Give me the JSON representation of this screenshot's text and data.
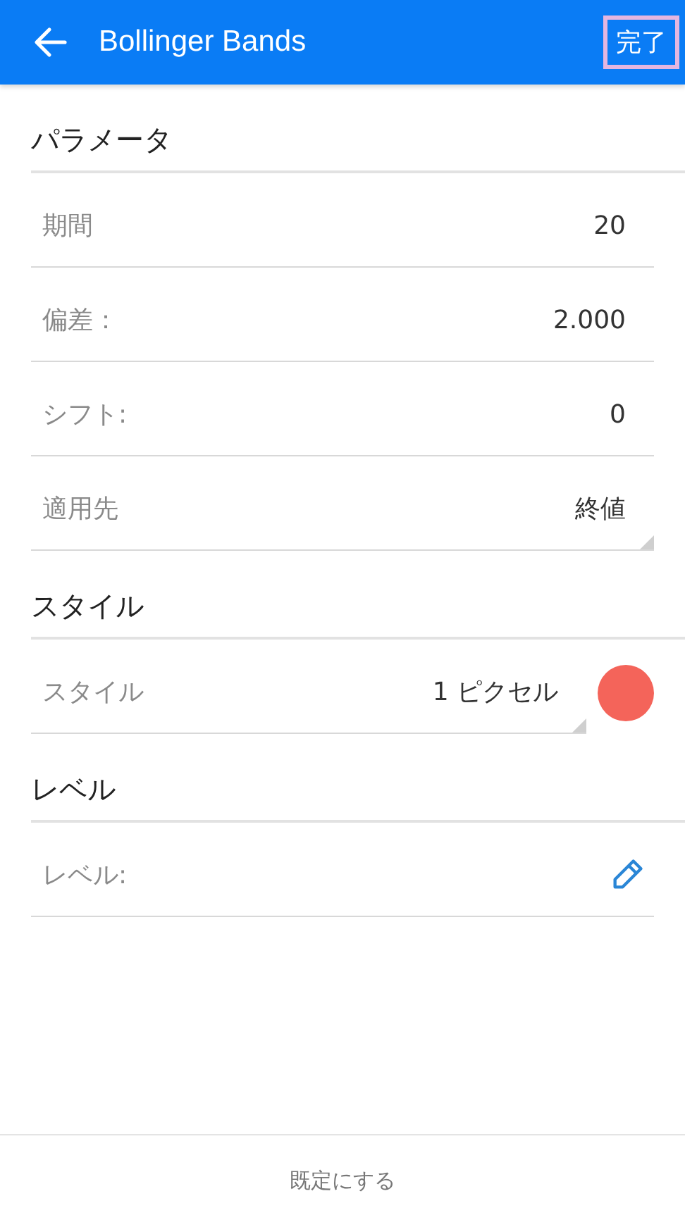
{
  "app_bar": {
    "title": "Bollinger Bands",
    "done_button": {
      "label": "完了",
      "outlined": true
    }
  },
  "sections": [
    {
      "title": "パラメータ",
      "fields": [
        {
          "kind": "input",
          "label": "期間",
          "value": "20"
        },
        {
          "kind": "input",
          "label": "偏差：",
          "value": "2.000"
        },
        {
          "kind": "input",
          "label": "シフト:",
          "value": "0"
        },
        {
          "kind": "select",
          "label": "適用先",
          "value": "終値"
        }
      ]
    },
    {
      "title": "スタイル",
      "fields": [
        {
          "kind": "style",
          "label": "スタイル",
          "value": "1 ピクセル",
          "color": "#f4645a"
        }
      ]
    },
    {
      "title": "レベル",
      "fields": [
        {
          "kind": "edit",
          "label": "レベル:"
        }
      ]
    }
  ],
  "footer": {
    "label": "既定にする"
  }
}
